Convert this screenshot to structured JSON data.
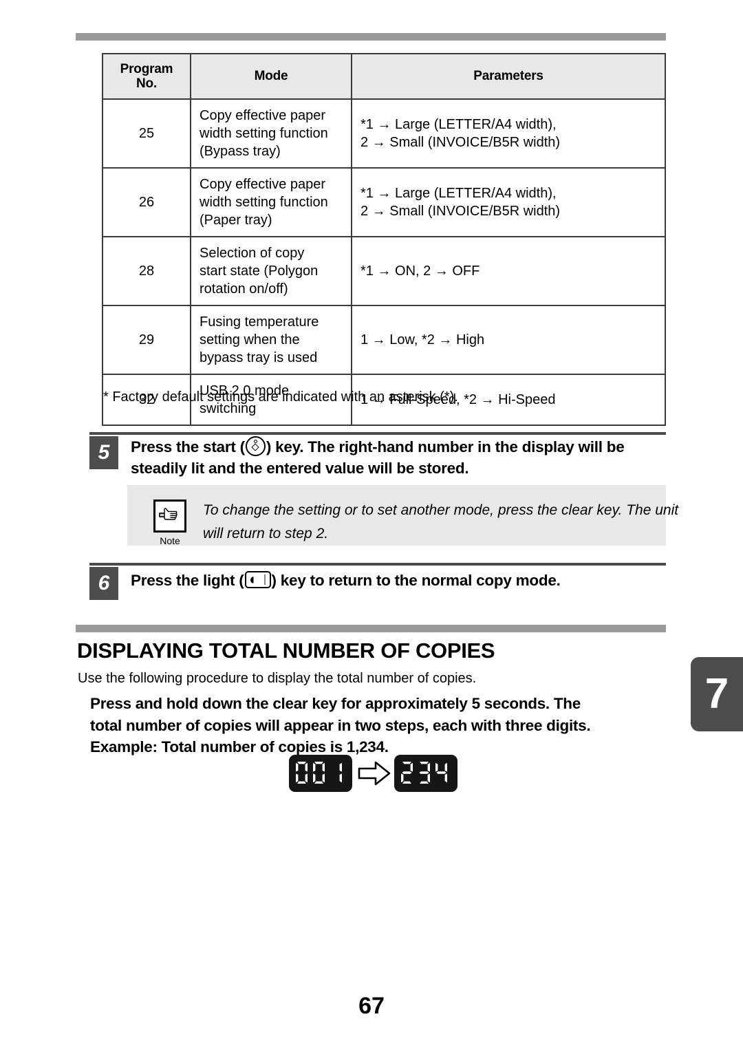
{
  "document": {
    "page_number": "67",
    "chapter_tab": "7"
  },
  "settings_table": {
    "headers": {
      "program_no": "Program\nNo.",
      "program_no_line1": "Program",
      "program_no_line2": "No.",
      "mode": "Mode",
      "parameters": "Parameters"
    },
    "rows": [
      {
        "no": "25",
        "mode_lines": [
          "Copy effective paper",
          "width setting function",
          "(Bypass tray)"
        ],
        "param_lines": [
          "*1 → Large (LETTER/A4 width),",
          "2 → Small (INVOICE/B5R width)"
        ]
      },
      {
        "no": "26",
        "mode_lines": [
          "Copy effective paper",
          "width setting function",
          "(Paper tray)"
        ],
        "param_lines": [
          "*1 → Large (LETTER/A4 width),",
          "2 → Small (INVOICE/B5R width)"
        ]
      },
      {
        "no": "28",
        "mode_lines": [
          "Selection of copy",
          "start state (Polygon",
          "rotation on/off)"
        ],
        "param_lines": [
          "*1 → ON, 2 → OFF"
        ]
      },
      {
        "no": "29",
        "mode_lines": [
          "Fusing temperature",
          "setting when the",
          "bypass tray is used"
        ],
        "param_lines": [
          "1 → Low, *2 → High"
        ]
      },
      {
        "no": "32",
        "mode_lines": [
          "USB 2.0 mode",
          "switching"
        ],
        "param_lines": [
          "1 → Full-Speed, *2 → Hi-Speed"
        ]
      }
    ],
    "footnote": "* Factory default settings are indicated with an asterisk (*)."
  },
  "step5": {
    "number": "5",
    "text_before_key": "Press the start (",
    "text_after_key": ") key. The right-hand number in the display will be steadily lit and the entered value will be stored.",
    "key_icon": "start-key-icon",
    "note": {
      "icon_label": "Note",
      "text": "To change the setting or to set another mode, press the clear key. The unit will return to step 2."
    }
  },
  "step6": {
    "number": "6",
    "text_before_key": "Press the light (",
    "text_after_key": ") key to return to the normal copy mode.",
    "key_icon": "light-key-icon"
  },
  "section": {
    "title": "DISPLAYING TOTAL NUMBER OF COPIES",
    "intro": "Use the following procedure to display the total number of copies.",
    "body_line1": "Press and hold down the clear key for approximately 5 seconds. The",
    "body_line2": "total number of copies will appear in two steps, each with three digits.",
    "body_line3": "Example: Total number of copies is 1,234."
  },
  "led_example": {
    "first_display": "001",
    "second_display": "234",
    "arrow": "right-arrow-icon",
    "panel_color": "#161616",
    "digit_color": "#ffffff"
  },
  "colors": {
    "rule_gray": "#9a9a9a",
    "badge_gray": "#4d4d4d",
    "note_bg": "#e8e8e8",
    "table_header_bg": "#e8e8e8",
    "table_border": "#3a3a3a"
  }
}
